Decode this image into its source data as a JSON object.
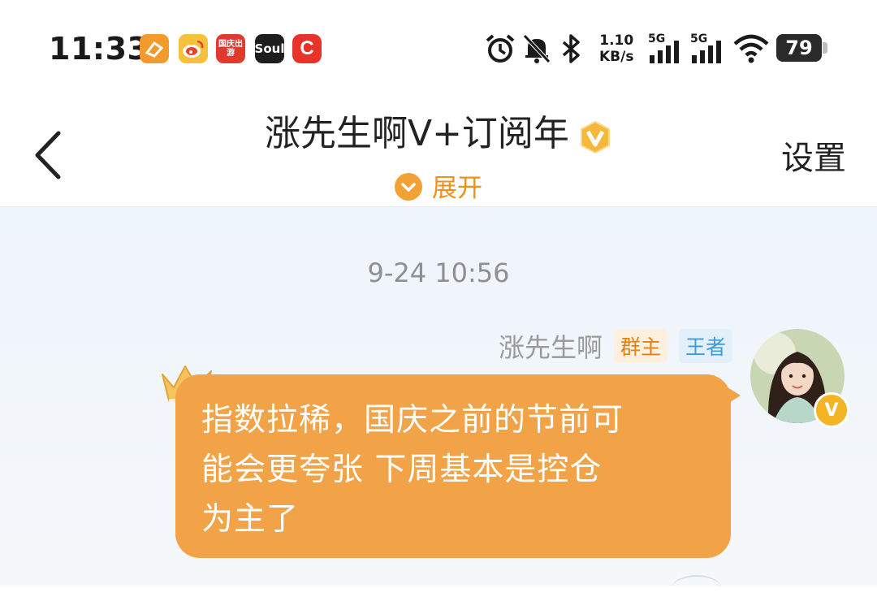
{
  "status_bar": {
    "time": "11:33",
    "apps": [
      "orange-app-icon",
      "weibo-icon",
      "guoqing-app-icon",
      "soul-icon",
      "c-app-icon"
    ],
    "guoqing_label": "国庆出游",
    "soul_label": "Soul",
    "c_label": "C",
    "net_speed_value": "1.10",
    "net_speed_unit": "KB/s",
    "signal1_label": "5G",
    "signal2_label": "5G",
    "battery": "79"
  },
  "header": {
    "title": "涨先生啊V+订阅年",
    "expand_label": "展开",
    "settings_label": "设置"
  },
  "chat": {
    "timestamp": "9-24 10:56",
    "message": {
      "sender": "涨先生啊",
      "tag_owner": "群主",
      "tag_rank": "王者",
      "text_line1": "指数拉稀，国庆之前的节前可",
      "text_line2": "能会更夸张 下周基本是控仓",
      "text_line3": "为主了"
    }
  },
  "colors": {
    "bubble": "#f2a348",
    "accent": "#ef8f1c",
    "rank_tag": "#3f9be0"
  }
}
